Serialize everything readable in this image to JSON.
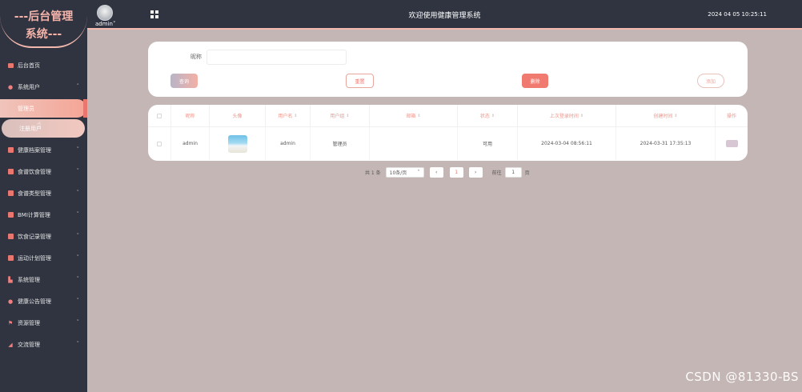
{
  "logo": {
    "line1": "---后台管理",
    "line2": "系统---"
  },
  "user": {
    "name": "admin",
    "chevron": "˅"
  },
  "header": {
    "title": "欢迎使用健康管理系统",
    "datetime": "2024 04 05 10:25:11"
  },
  "sidebar": {
    "items": [
      {
        "label": "后台首页",
        "icon": "monitor-icon"
      },
      {
        "label": "系统用户",
        "icon": "user-icon",
        "expanded": true,
        "children": [
          {
            "label": "管理员",
            "active": true
          },
          {
            "label": "注册用户",
            "active": false
          }
        ]
      },
      {
        "label": "健康档案管理",
        "icon": "chart-icon"
      },
      {
        "label": "食谱饮食管理",
        "icon": "chart-icon"
      },
      {
        "label": "食谱类型管理",
        "icon": "chart-icon"
      },
      {
        "label": "BMI计算管理",
        "icon": "chart-icon"
      },
      {
        "label": "饮食记录管理",
        "icon": "chart-icon"
      },
      {
        "label": "运动计划管理",
        "icon": "chart-icon"
      },
      {
        "label": "系统管理",
        "icon": "bars-icon"
      },
      {
        "label": "健康公告管理",
        "icon": "info-icon"
      },
      {
        "label": "资源管理",
        "icon": "flag-icon"
      },
      {
        "label": "交流管理",
        "icon": "send-icon"
      }
    ]
  },
  "search": {
    "nickname_label": "昵称",
    "nickname_value": "",
    "query_label": "查询",
    "reset_label": "重置",
    "delete_label": "删除",
    "add_label": "添加"
  },
  "table": {
    "columns": [
      "",
      "昵称",
      "头像",
      "用户名",
      "用户组",
      "邮箱",
      "状态",
      "上次登录时间",
      "创建时间",
      "操作"
    ],
    "rows": [
      {
        "nickname": "admin",
        "username": "admin",
        "group": "管理员",
        "email": "",
        "status": "可用",
        "last_login": "2024-03-04 08:56:11",
        "created": "2024-03-31 17:35:13"
      }
    ]
  },
  "pager": {
    "total": "共 1 条",
    "page_size": "10条/页",
    "prev": "‹",
    "current": "1",
    "next": "›",
    "goto_label": "前往",
    "goto_value": "1",
    "unit": "页"
  },
  "watermark": "CSDN @81330-BS",
  "colors": {
    "accent": "#e9776f",
    "sidebar_bg": "#2f3440",
    "page_bg": "#c4b6b4",
    "pink": "#f2b7ad"
  }
}
